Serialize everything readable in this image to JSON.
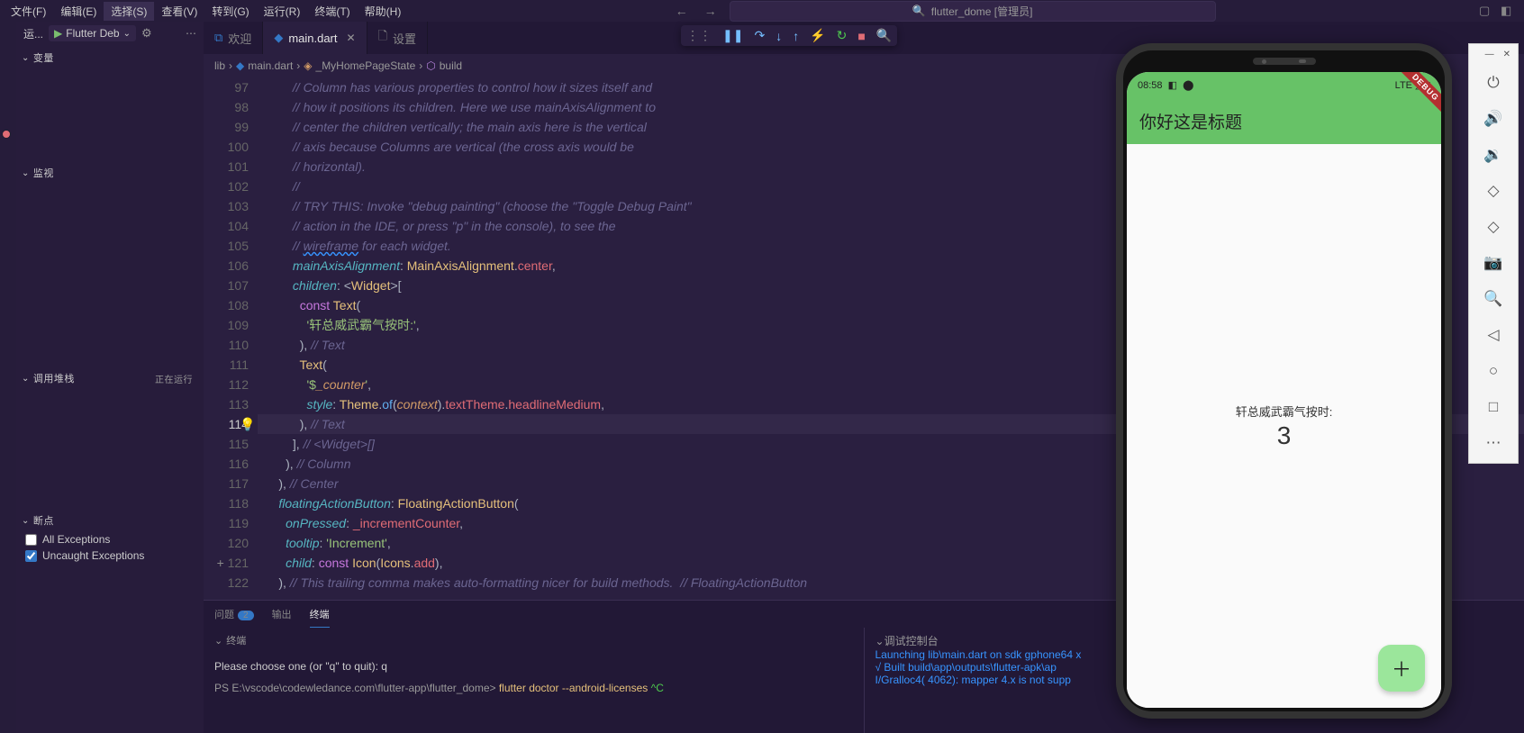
{
  "menubar": {
    "items": [
      "文件(F)",
      "编辑(E)",
      "选择(S)",
      "查看(V)",
      "转到(G)",
      "运行(R)",
      "终端(T)",
      "帮助(H)"
    ],
    "selected_index": 2,
    "search": "flutter_dome [管理员]"
  },
  "left": {
    "run_label": "运...",
    "config": "Flutter Deb",
    "sections": {
      "variables": "变量",
      "watch": "监视",
      "callstack": "调用堆栈",
      "callstack_status": "正在运行",
      "breakpoints": "断点",
      "bp_all": "All Exceptions",
      "bp_uncaught": "Uncaught Exceptions"
    }
  },
  "tabs": {
    "welcome": "欢迎",
    "file": "main.dart",
    "settings": "设置"
  },
  "breadcrumb": {
    "folder": "lib",
    "file": "main.dart",
    "class": "_MyHomePageState",
    "method": "build"
  },
  "code": {
    "lines": [
      {
        "n": 97,
        "html": "<span class='c-com'>// Column has various properties to control how it sizes itself and</span>"
      },
      {
        "n": 98,
        "html": "<span class='c-com'>// how it positions its children. Here we use mainAxisAlignment to</span>"
      },
      {
        "n": 99,
        "html": "<span class='c-com'>// center the children vertically; the main axis here is the vertical</span>"
      },
      {
        "n": 100,
        "html": "<span class='c-com'>// axis because Columns are vertical (the cross axis would be</span>"
      },
      {
        "n": 101,
        "html": "<span class='c-com'>// horizontal).</span>"
      },
      {
        "n": 102,
        "html": "<span class='c-com'>//</span>"
      },
      {
        "n": 103,
        "html": "<span class='c-com'>// TRY THIS: Invoke \"debug painting\" (choose the \"Toggle Debug Paint\"</span>"
      },
      {
        "n": 104,
        "html": "<span class='c-com'>// action in the IDE, or press \"p\" in the console), to see the</span>"
      },
      {
        "n": 105,
        "html": "<span class='c-com'>// <span class='wavy'>wireframe</span> for each widget.</span>"
      },
      {
        "n": 106,
        "html": "<span class='c-prop'>mainAxisAlignment</span><span class='c-punc'>: </span><span class='c-class'>MainAxisAlignment</span><span class='c-punc'>.</span><span class='c-const'>center</span><span class='c-punc'>,</span>"
      },
      {
        "n": 107,
        "html": "<span class='c-prop'>children</span><span class='c-punc'>: &lt;</span><span class='c-class'>Widget</span><span class='c-punc'>&gt;[</span>"
      },
      {
        "n": 108,
        "html": "  <span class='c-key'>const</span> <span class='c-class'>Text</span><span class='c-punc'>(</span>"
      },
      {
        "n": 109,
        "html": "    <span class='c-str'>'轩总威武霸气按时:'</span><span class='c-punc'>,</span>"
      },
      {
        "n": 110,
        "html": "  <span class='c-punc'>),</span> <span class='c-com'>// Text</span>"
      },
      {
        "n": 111,
        "html": "  <span class='c-class'>Text</span><span class='c-punc'>(</span>"
      },
      {
        "n": 112,
        "html": "    <span class='c-str'>'$<span class='c-var'>_counter</span>'</span><span class='c-punc'>,</span>"
      },
      {
        "n": 113,
        "html": "    <span class='c-prop'>style</span><span class='c-punc'>: </span><span class='c-class'>Theme</span><span class='c-punc'>.</span><span class='c-fn'>of</span><span class='c-punc'>(</span><span class='c-var'>context</span><span class='c-punc'>).</span><span class='c-const'>textTheme</span><span class='c-punc'>.</span><span class='c-const'>headlineMedium</span><span class='c-punc'>,</span>"
      },
      {
        "n": 114,
        "html": "  <span class='c-punc'>),</span> <span class='c-com'>// Text</span>",
        "current": true
      },
      {
        "n": 115,
        "html": "<span class='c-punc'>],</span> <span class='c-com'>// &lt;Widget&gt;[]</span>"
      },
      {
        "n": 116,
        "html": "<span class='c-punc'>),</span> <span class='c-com'>// Column</span>",
        "dedent": 1
      },
      {
        "n": 117,
        "html": "<span class='c-punc'>),</span> <span class='c-com'>// Center</span>",
        "dedent": 2
      },
      {
        "n": 118,
        "html": "<span class='c-prop'>floatingActionButton</span><span class='c-punc'>: </span><span class='c-class'>FloatingActionButton</span><span class='c-punc'>(</span>",
        "dedent": 2
      },
      {
        "n": 119,
        "html": "<span class='c-prop'>onPressed</span><span class='c-punc'>: </span><span class='c-const'>_incrementCounter</span><span class='c-punc'>,</span>",
        "dedent": 1
      },
      {
        "n": 120,
        "html": "<span class='c-prop'>tooltip</span><span class='c-punc'>: </span><span class='c-str'>'Increment'</span><span class='c-punc'>,</span>",
        "dedent": 1
      },
      {
        "n": 121,
        "html": "<span class='c-prop'>child</span><span class='c-punc'>: </span><span class='c-key'>const</span> <span class='c-class'>Icon</span><span class='c-punc'>(</span><span class='c-class'>Icons</span><span class='c-punc'>.</span><span class='c-const'>add</span><span class='c-punc'>),</span>",
        "dedent": 1,
        "addmark": true
      },
      {
        "n": 122,
        "html": "<span class='c-punc'>),</span> <span class='c-com'>// This trailing comma makes auto-formatting nicer for build methods.</span>  <span class='c-com'>// FloatingActionButton</span>",
        "dedent": 2
      }
    ]
  },
  "panel": {
    "tabs": {
      "problems": "问题",
      "problems_count": "2",
      "output": "输出",
      "terminal": "终端"
    },
    "terminal_header": "终端",
    "debug_header": "调试控制台",
    "term_line1": "Please choose one (or \"q\" to quit): q",
    "term_line2_prefix": "PS E:\\vscode\\codewledance.com\\flutter-app\\flutter_dome> ",
    "term_line2_cmd": "flutter doctor --android-licenses",
    "term_line2_suffix": "^C",
    "dbg_line1": "Launching lib\\main.dart on sdk gphone64 x",
    "dbg_line2": "√  Built build\\app\\outputs\\flutter-apk\\ap",
    "dbg_line3": "I/Gralloc4( 4062): mapper 4.x is not supp"
  },
  "emulator": {
    "time": "08:58",
    "net": "LTE",
    "title": "你好这是标题",
    "body_text": "轩总威武霸气按时:",
    "counter": "3",
    "debug": "DEBUG"
  }
}
